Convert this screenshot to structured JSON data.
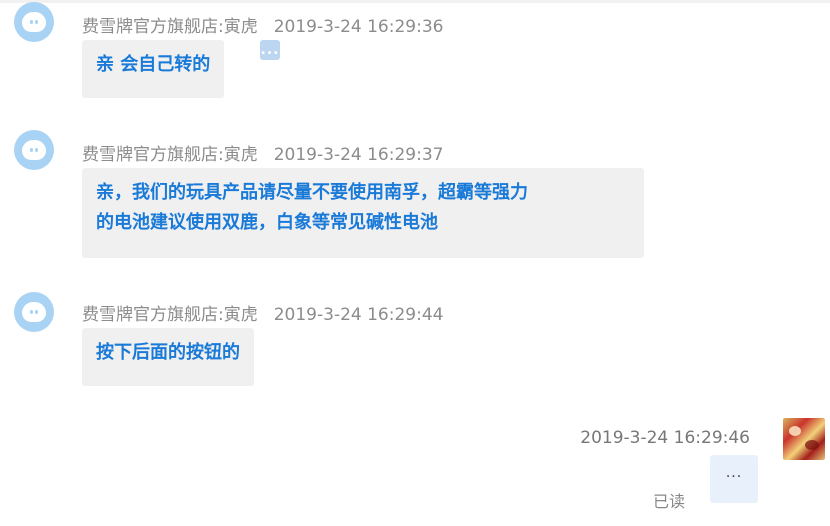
{
  "messages": [
    {
      "sender": "费雪牌官方旗舰店:寅虎",
      "time": "2019-3-24 16:29:36",
      "text": "亲 会自己转的"
    },
    {
      "sender": "费雪牌官方旗舰店:寅虎",
      "time": "2019-3-24 16:29:37",
      "line1": "亲，我们的玩具产品请尽量不要使用南孚，超霸等强力",
      "line2": "的电池建议使用双鹿，白象等常见碱性电池"
    },
    {
      "sender": "费雪牌官方旗舰店:寅虎",
      "time": "2019-3-24 16:29:44",
      "text": "按下后面的按钮的"
    }
  ],
  "outgoing": {
    "time": "2019-3-24 16:29:46",
    "typing_text": "...",
    "read_status": "已读"
  },
  "icons": {
    "more_dots": "...",
    "avatar": "shop-avatar-icon",
    "user_avatar": "user-avatar"
  },
  "colors": {
    "message_text": "#1a7ad8",
    "bubble_bg": "#f0f0f0",
    "meta_text": "#8c8c8c",
    "avatar_bg": "#a9d3f5"
  }
}
